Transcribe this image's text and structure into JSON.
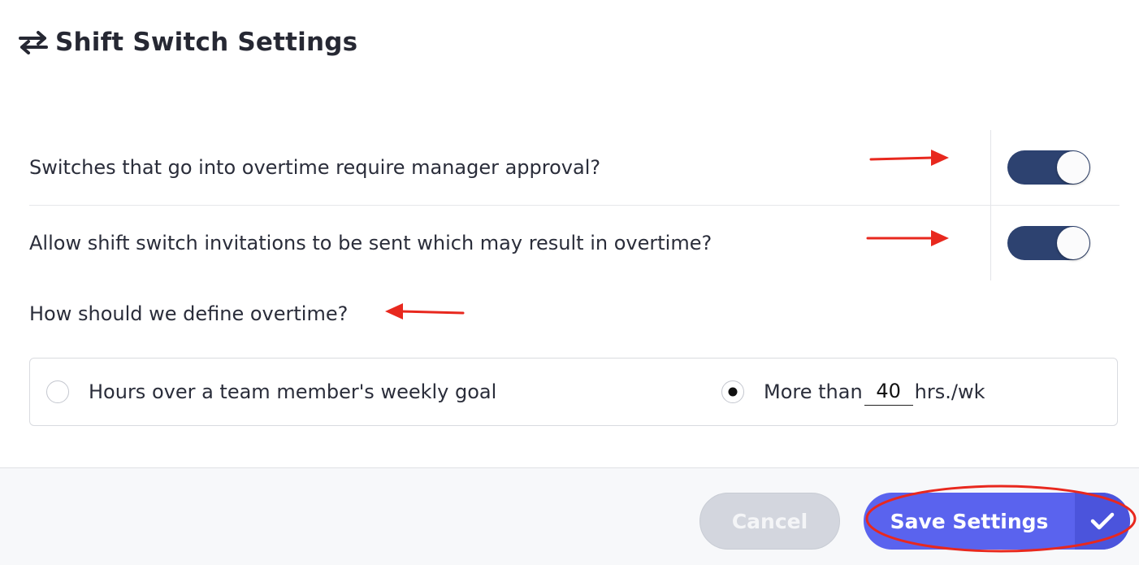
{
  "header": {
    "icon": "switch-arrows-icon",
    "title": "Shift Switch Settings"
  },
  "settings": [
    {
      "label": "Switches that go into overtime require manager approval?",
      "enabled": true
    },
    {
      "label": "Allow shift switch invitations to be sent which may result in overtime?",
      "enabled": true
    }
  ],
  "overtime": {
    "question": "How should we define overtime?",
    "option_goal_label": "Hours over a team member's weekly goal",
    "option_hours_prefix": "More than",
    "option_hours_value": "40",
    "option_hours_suffix": "hrs./wk",
    "selected": "hours"
  },
  "footer": {
    "cancel_label": "Cancel",
    "save_label": "Save Settings",
    "save_icon": "checkmark-icon"
  },
  "colors": {
    "toggle_on": "#2d4270",
    "primary_button": "#5a63ee",
    "cancel_button": "#d3d6de",
    "annotation": "#e8281e"
  }
}
